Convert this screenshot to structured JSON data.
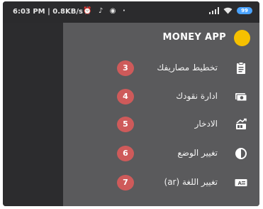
{
  "status_bar": {
    "time_speed": "6:03 PM | 0.8KB/s",
    "app_glyphs": "⏰ ♪ ◉ ·",
    "battery": "99"
  },
  "drawer": {
    "app_title": "MONEY APP",
    "items": [
      {
        "badge": "3",
        "label": "تخطيط مصاريفك",
        "icon": "clipboard-icon"
      },
      {
        "badge": "4",
        "label": "ادارة نقودك",
        "icon": "money-icon"
      },
      {
        "badge": "5",
        "label": "الادخار",
        "icon": "savings-icon"
      },
      {
        "badge": "6",
        "label": "تغيير الوضع",
        "icon": "theme-contrast-icon"
      },
      {
        "badge": "7",
        "label": "تغيير اللغة (ar)",
        "icon": "language-icon"
      }
    ]
  },
  "colors": {
    "drawer_bg": "#5a5a5c",
    "badge": "#ce5a5a",
    "app_dot": "#f5c000",
    "battery": "#4aa3ff"
  }
}
